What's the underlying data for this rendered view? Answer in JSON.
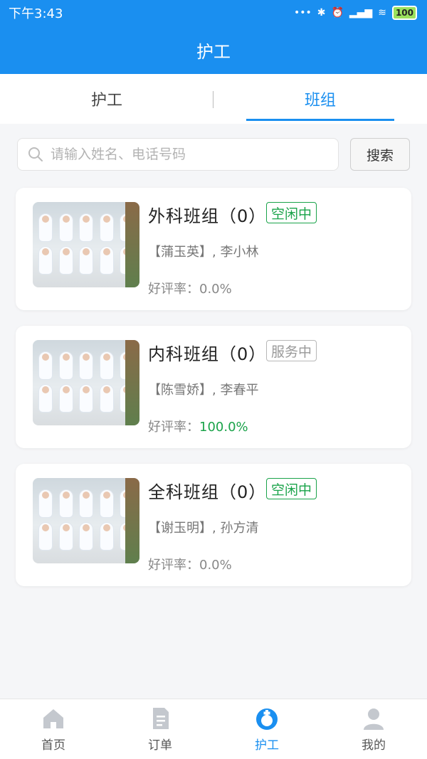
{
  "status": {
    "time": "下午3:43",
    "battery": "100"
  },
  "header": {
    "title": "护工"
  },
  "tabs": [
    {
      "label": "护工",
      "active": false
    },
    {
      "label": "班组",
      "active": true
    }
  ],
  "search": {
    "placeholder": "请输入姓名、电话号码",
    "button_label": "搜索"
  },
  "teams": [
    {
      "name": "外科班组（0）",
      "status": "空闲中",
      "status_type": "idle",
      "members": "【蒲玉英】, 李小林",
      "rating_label": "好评率：",
      "rating_value": "0.0%"
    },
    {
      "name": "内科班组（0）",
      "status": "服务中",
      "status_type": "busy",
      "members": "【陈雪娇】, 李春平",
      "rating_label": "好评率：",
      "rating_value": "100.0%"
    },
    {
      "name": "全科班组（0）",
      "status": "空闲中",
      "status_type": "idle",
      "members": "【谢玉明】, 孙方清",
      "rating_label": "好评率：",
      "rating_value": "0.0%"
    }
  ],
  "bottom_nav": [
    {
      "label": "首页",
      "icon": "home-icon",
      "active": false
    },
    {
      "label": "订单",
      "icon": "document-icon",
      "active": false
    },
    {
      "label": "护工",
      "icon": "nurse-icon",
      "active": true
    },
    {
      "label": "我的",
      "icon": "user-icon",
      "active": false
    }
  ],
  "colors": {
    "primary": "#1a8ff0",
    "green": "#1aa34a",
    "busy_gray": "#999999"
  }
}
